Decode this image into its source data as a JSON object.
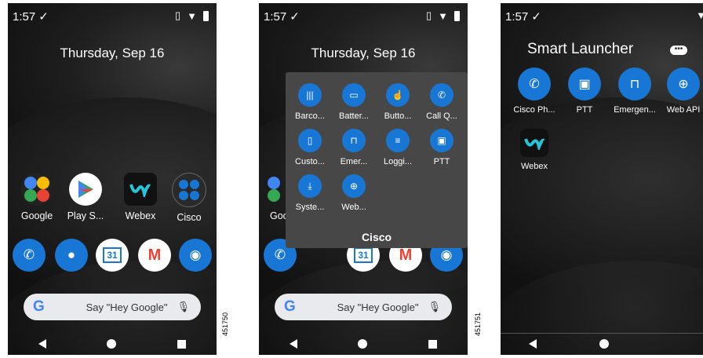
{
  "panel1": {
    "status_time": "1:57",
    "status_check": "✓",
    "date": "Thursday, Sep 16",
    "apps": [
      "Google",
      "Play S...",
      "Webex",
      "Cisco"
    ],
    "search_hint": "Say \"Hey Google\"",
    "figure_id": "451750"
  },
  "panel2": {
    "status_time": "1:57",
    "status_check": "✓",
    "date": "Thursday, Sep 16",
    "folder_items": [
      "Barco...",
      "Batter...",
      "Butto...",
      "Call Q...",
      "Custo...",
      "Emer...",
      "Loggi...",
      "PTT",
      "Syste...",
      "Web..."
    ],
    "folder_title": "Cisco",
    "under_label": "Goc",
    "search_hint": "Say \"Hey Google\"",
    "figure_id": "451751"
  },
  "panel3": {
    "status_time": "1:57",
    "status_check": "✓",
    "title": "Smart Launcher",
    "items": [
      "Cisco Ph...",
      "PTT",
      "Emergen...",
      "Web API",
      "Webex"
    ]
  },
  "colors": {
    "accent": "#1877d4",
    "folder_bg": "#474747",
    "search_bg": "#e8eaed"
  },
  "icons": [
    "phone-icon",
    "contacts-icon",
    "calendar-icon",
    "gmail-icon",
    "camera-icon",
    "mic-icon",
    "google-g-icon"
  ],
  "calendar_day": "31"
}
